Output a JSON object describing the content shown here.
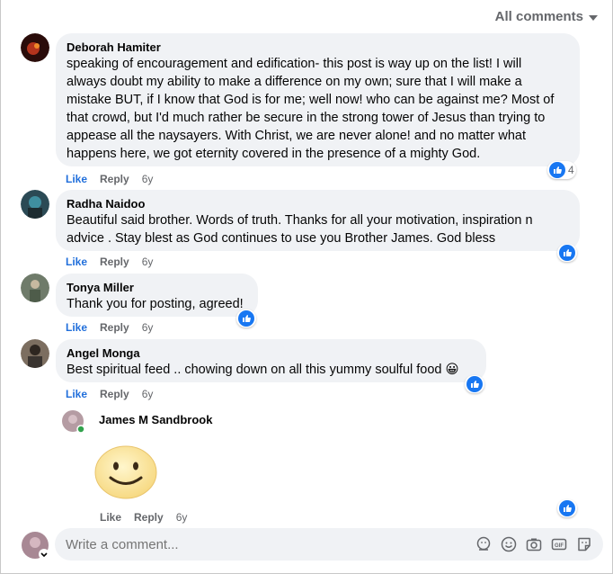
{
  "header": {
    "filter_label": "All comments"
  },
  "comments": [
    {
      "author": "Deborah Hamiter",
      "lines": [
        "speaking of encouragement and edification- this post is way up on the list! I will",
        "always doubt my ability to make a difference on my own; sure that I will make a",
        "mistake BUT, if I know that God is for me; well now! who can be against me? Most of",
        "that crowd, but I'd much rather be secure in the strong tower of Jesus than trying to",
        "appease all the naysayers. With Christ, we are never alone! and no matter what",
        "happens here, we got eternity covered in the presence of a mighty God."
      ],
      "like": "Like",
      "reply": "Reply",
      "time": "6y",
      "reaction_count": "4"
    },
    {
      "author": "Radha Naidoo",
      "lines": [
        "Beautiful said brother. Words of truth. Thanks for all your motivation, inspiration n",
        "advice . Stay blest as God continues to use you Brother James. God bless"
      ],
      "like": "Like",
      "reply": "Reply",
      "time": "6y"
    },
    {
      "author": "Tonya Miller",
      "lines": [
        "Thank you for posting, agreed!"
      ],
      "like": "Like",
      "reply": "Reply",
      "time": "6y"
    },
    {
      "author": "Angel Monga",
      "lines": [
        "Best spiritual feed .. chowing down on all this yummy soulful food 😀"
      ],
      "like": "Like",
      "reply": "Reply",
      "time": "6y"
    }
  ],
  "reply": {
    "author": "James M Sandbrook",
    "sticker": "smiley-face-sticker",
    "like": "Like",
    "reply": "Reply",
    "time": "6y"
  },
  "composer": {
    "placeholder": "Write a comment...",
    "tools": [
      "avatar-sticker-icon",
      "emoji-icon",
      "camera-icon",
      "gif-icon",
      "sticker-icon"
    ]
  },
  "colors": {
    "accent": "#1877f2",
    "bubble": "#f0f2f5",
    "muted": "#65676b"
  }
}
